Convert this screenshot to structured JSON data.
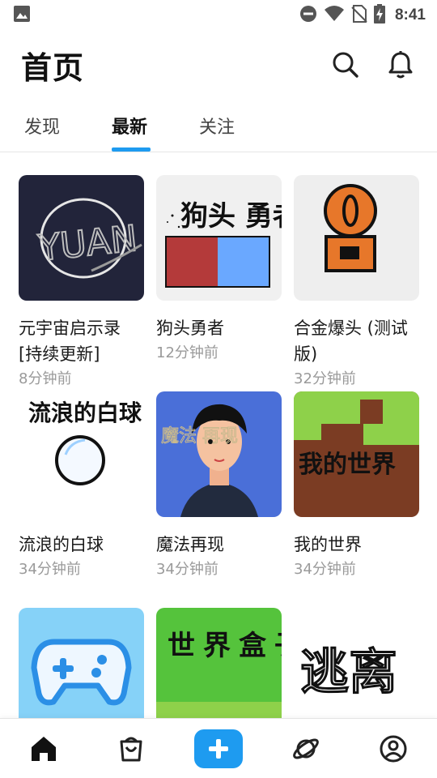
{
  "status_bar": {
    "time": "8:41",
    "icons": [
      "image-icon",
      "do-not-disturb-icon",
      "wifi-icon",
      "no-sim-icon",
      "battery-charging-icon"
    ]
  },
  "header": {
    "title": "首页",
    "actions": [
      "search-icon",
      "bell-icon"
    ]
  },
  "tabs": [
    {
      "label": "发现",
      "active": false
    },
    {
      "label": "最新",
      "active": true
    },
    {
      "label": "关注",
      "active": false
    }
  ],
  "colors": {
    "accent": "#1e9bf0",
    "text": "#1a1a1a",
    "muted": "#9a9a9a"
  },
  "works": [
    {
      "title": "元宇宙启示录[持续更新]",
      "time": "8分钟前",
      "thumb_text": "YUAN"
    },
    {
      "title": "狗头勇者",
      "time": "12分钟前",
      "thumb_text": "狗头 勇者!"
    },
    {
      "title": "合金爆头 (测试版)",
      "time": "32分钟前"
    },
    {
      "title": "流浪的白球",
      "time": "34分钟前",
      "thumb_text": "流浪的白球"
    },
    {
      "title": "魔法再现",
      "time": "34分钟前",
      "thumb_text": "魔法 再现"
    },
    {
      "title": "我的世界",
      "time": "34分钟前",
      "thumb_text": "我的世界"
    },
    {
      "title": "",
      "time": ""
    },
    {
      "title": "",
      "time": "",
      "thumb_text": "世界盒子"
    },
    {
      "title": "",
      "time": "",
      "thumb_text": "逃离"
    }
  ],
  "bottom_nav": [
    "home-icon",
    "shop-icon",
    "create-icon",
    "planet-icon",
    "profile-icon"
  ]
}
